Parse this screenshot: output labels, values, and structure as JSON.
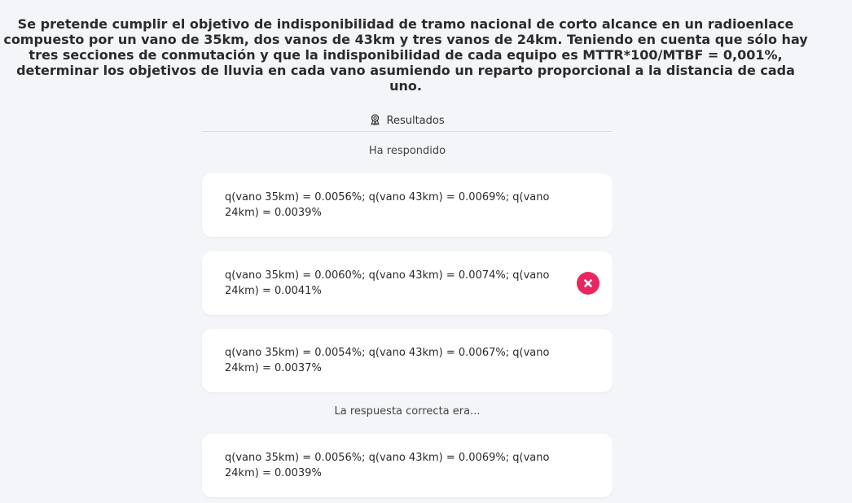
{
  "question": "Se pretende cumplir el objetivo de indisponibilidad de tramo nacional de corto alcance en un radioenlace compuesto por un vano de 35km, dos vanos de 43km y tres vanos de 24km. Teniendo en cuenta que sólo hay tres secciones de conmutación y que la indisponibilidad de cada equipo es MTTR*100/MTBF = 0,001%, determinar los objetivos de lluvia en cada vano asumiendo un reparto proporcional a la distancia de cada uno.",
  "results": {
    "title": "Resultados",
    "icon": "award-ribbon-icon"
  },
  "answered_label": "Ha respondido",
  "answers": [
    {
      "text": "q(vano 35km) = 0.0056%; q(vano 43km) = 0.0069%; q(vano 24km) = 0.0039%"
    },
    {
      "text": "q(vano 35km) = 0.0060%; q(vano 43km) = 0.0074%; q(vano 24km) = 0.0041%",
      "status": "wrong",
      "status_icon": "close-icon",
      "status_color": "#e8275f"
    },
    {
      "text": "q(vano 35km) = 0.0054%; q(vano 43km) = 0.0067%; q(vano 24km) = 0.0037%"
    }
  ],
  "correct_label": "La respuesta correcta era...",
  "correct_answer": {
    "text": "q(vano 35km) = 0.0056%; q(vano 43km) = 0.0069%; q(vano 24km) = 0.0039%"
  }
}
